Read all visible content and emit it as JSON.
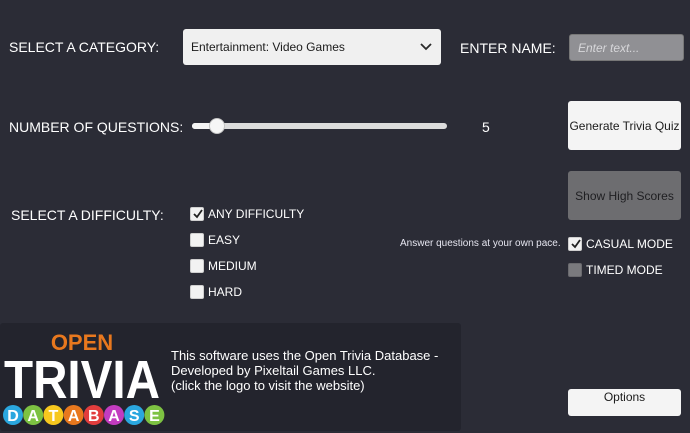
{
  "category": {
    "label": "SELECT A CATEGORY:",
    "selected": "Entertainment: Video Games"
  },
  "name": {
    "label": "ENTER NAME:",
    "placeholder": "Enter text...",
    "value": ""
  },
  "questions": {
    "label": "NUMBER OF QUESTIONS:",
    "value": "5",
    "slider_fraction": 0.1
  },
  "buttons": {
    "generate": "Generate Trivia Quiz",
    "high_scores": "Show High Scores",
    "options": "Options"
  },
  "difficulty": {
    "label": "SELECT A DIFFICULTY:",
    "options": [
      {
        "label": "ANY DIFFICULTY",
        "checked": true
      },
      {
        "label": "EASY",
        "checked": false
      },
      {
        "label": "MEDIUM",
        "checked": false
      },
      {
        "label": "HARD",
        "checked": false
      }
    ]
  },
  "mode": {
    "tooltip": "Answer questions at your own pace.",
    "casual": {
      "label": "CASUAL MODE",
      "checked": true
    },
    "timed": {
      "label": "TIMED MODE",
      "checked": false
    }
  },
  "info": {
    "lines": [
      "This software uses the Open Trivia Database -",
      "Developed by Pixeltail Games LLC.",
      "(click the logo to visit the website)"
    ]
  },
  "logo": {
    "top": "OPEN",
    "middle": "TRIVIA",
    "bottom": [
      "D",
      "A",
      "T",
      "A",
      "B",
      "A",
      "S",
      "E"
    ],
    "colors": {
      "open": "#e8781e",
      "trivia": "#ffffff",
      "bottom": [
        "#2aa7df",
        "#7dc242",
        "#f7c81e",
        "#e8781e",
        "#e23d3d",
        "#c33cc0",
        "#2aa7df",
        "#7dc242"
      ]
    }
  },
  "colors": {
    "background": "#2b2c36",
    "panel": "#23242d",
    "button": "#f4f4f4",
    "button_disabled": "#6d6d70"
  }
}
